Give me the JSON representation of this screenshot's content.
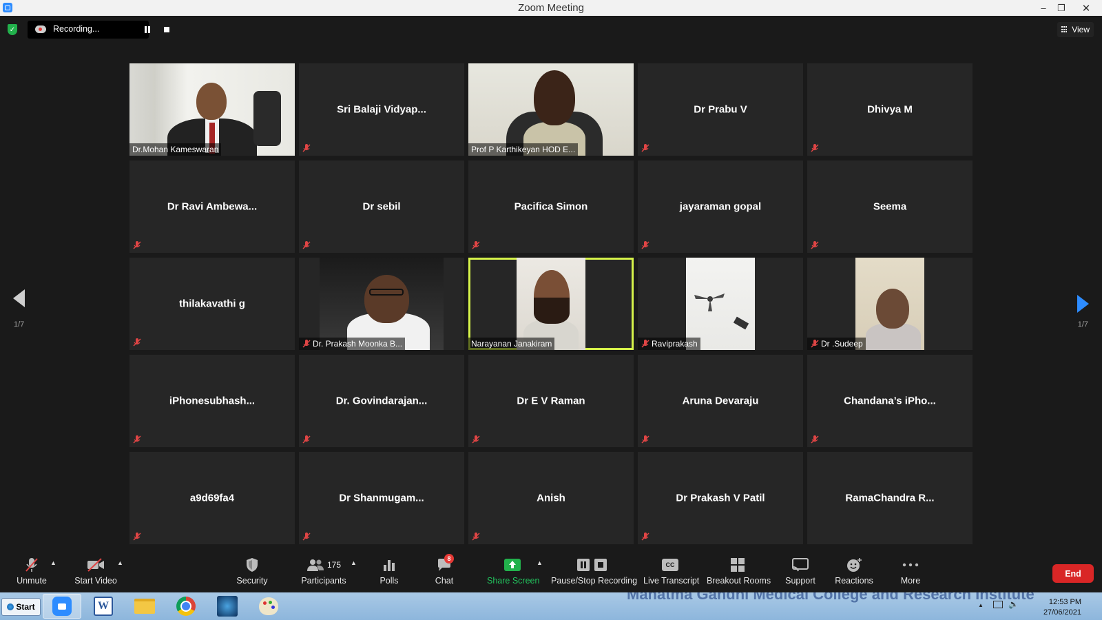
{
  "window": {
    "title": "Zoom Meeting",
    "minimize": "–",
    "restore": "❐",
    "close": "✕"
  },
  "top_bar": {
    "recording_label": "Recording...",
    "view_label": "View"
  },
  "pagination": {
    "left": "1/7",
    "right": "1/7"
  },
  "participants": [
    {
      "name": "Dr.Mohan Kameswaran",
      "video": true,
      "muted": false
    },
    {
      "name": "Sri Balaji Vidyap...",
      "video": false,
      "muted": true
    },
    {
      "name": "Prof P Karthikeyan HOD E...",
      "video": true,
      "muted": false
    },
    {
      "name": "Dr Prabu V",
      "video": false,
      "muted": true
    },
    {
      "name": "Dhivya M",
      "video": false,
      "muted": true
    },
    {
      "name": "Dr Ravi Ambewa...",
      "video": false,
      "muted": true
    },
    {
      "name": "Dr sebil",
      "video": false,
      "muted": true
    },
    {
      "name": "Pacifica Simon",
      "video": false,
      "muted": true
    },
    {
      "name": "jayaraman gopal",
      "video": false,
      "muted": true
    },
    {
      "name": "Seema",
      "video": false,
      "muted": true
    },
    {
      "name": "thilakavathi g",
      "video": false,
      "muted": true
    },
    {
      "name": "Dr. Prakash Moonka B...",
      "video": true,
      "muted": true
    },
    {
      "name": "Narayanan Janakiram",
      "video": true,
      "muted": false,
      "active_speaker": true
    },
    {
      "name": "Raviprakash",
      "video": true,
      "muted": true
    },
    {
      "name": "Dr .Sudeep",
      "video": true,
      "muted": true
    },
    {
      "name": "iPhonesubhash...",
      "video": false,
      "muted": true
    },
    {
      "name": "Dr.  Govindarajan...",
      "video": false,
      "muted": true
    },
    {
      "name": "Dr E V Raman",
      "video": false,
      "muted": true
    },
    {
      "name": "Aruna Devaraju",
      "video": false,
      "muted": true
    },
    {
      "name": "Chandana’s  iPho...",
      "video": false,
      "muted": true
    },
    {
      "name": "a9d69fa4",
      "video": false,
      "muted": true
    },
    {
      "name": "Dr  Shanmugam...",
      "video": false,
      "muted": true
    },
    {
      "name": "Anish",
      "video": false,
      "muted": true
    },
    {
      "name": "Dr Prakash V Patil",
      "video": false,
      "muted": true
    },
    {
      "name": "RamaChandra  R...",
      "video": false,
      "muted": true
    }
  ],
  "toolbar": {
    "unmute": "Unmute",
    "start_video": "Start Video",
    "security": "Security",
    "participants": "Participants",
    "participants_count": "175",
    "polls": "Polls",
    "chat": "Chat",
    "chat_badge": "8",
    "share_screen": "Share Screen",
    "pause_stop_recording": "Pause/Stop Recording",
    "live_transcript": "Live Transcript",
    "live_transcript_icon_text": "CC",
    "breakout_rooms": "Breakout Rooms",
    "support": "Support",
    "reactions": "Reactions",
    "more": "More",
    "end": "End"
  },
  "taskbar": {
    "start": "Start",
    "wallpaper_text": "Mahatma Gandhi Medical College and Research Institute",
    "time": "12:53 PM",
    "date": "27/06/2021"
  },
  "colors": {
    "active_speaker_border": "#d6f34a",
    "end_button": "#d92626",
    "share_screen_green": "#22b14c",
    "accent_blue": "#2d8cff"
  }
}
